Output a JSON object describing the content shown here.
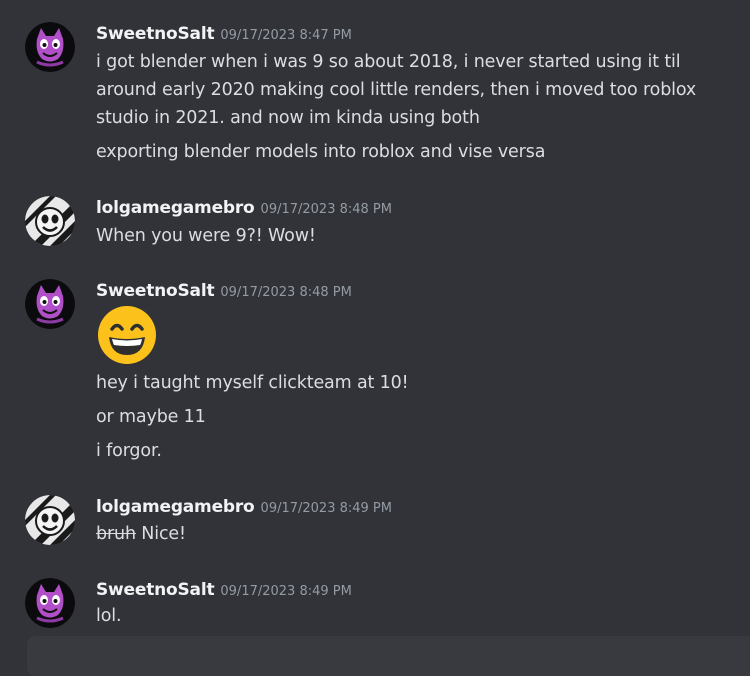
{
  "colors": {
    "background": "#313338",
    "username": "#f2f3f5",
    "timestamp": "#949ba4",
    "text": "#dbdee1",
    "avatar_purple": "#b04fc8"
  },
  "messages": [
    {
      "author": "SweetnoSalt",
      "timestamp": "09/17/2023 8:47 PM",
      "avatar": "purple-cat-avatar",
      "lines": [
        "i got blender when i was 9 so about 2018, i never started using it til",
        "around early 2020 making cool little renders, then i moved too roblox",
        "studio in 2021. and now im kinda using both",
        "exporting blender models into roblox and vise versa"
      ]
    },
    {
      "author": "lolgamegamebro",
      "timestamp": "09/17/2023 8:48 PM",
      "avatar": "striped-skull-avatar",
      "lines": [
        "When you were 9?! Wow!"
      ]
    },
    {
      "author": "SweetnoSalt",
      "timestamp": "09/17/2023 8:48 PM",
      "avatar": "purple-cat-avatar",
      "emoji": "grinning-squinting-face-emoji",
      "lines": [
        "hey i taught myself clickteam at 10!",
        "or maybe 11",
        "i forgor."
      ]
    },
    {
      "author": "lolgamegamebro",
      "timestamp": "09/17/2023 8:49 PM",
      "avatar": "striped-skull-avatar",
      "strike_text": "bruh",
      "text_after": " Nice!"
    },
    {
      "author": "SweetnoSalt",
      "timestamp": "09/17/2023 8:49 PM",
      "avatar": "purple-cat-avatar",
      "lines": [
        "lol."
      ]
    }
  ]
}
